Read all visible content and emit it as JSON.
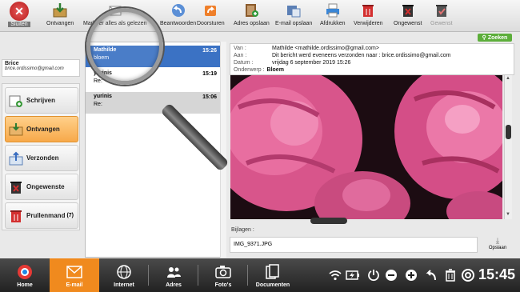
{
  "toolbar": {
    "close_label": "Sluiten",
    "buttons": [
      {
        "label": "Ontvangen",
        "icon": "inbox-download-icon"
      },
      {
        "label": "Markeer alles als gelezen",
        "icon": "mark-read-icon"
      },
      {
        "label": "Beantwoorden",
        "icon": "reply-icon"
      },
      {
        "label": "Doorsturen",
        "icon": "forward-icon"
      },
      {
        "label": "Adres opslaan",
        "icon": "save-address-icon"
      },
      {
        "label": "E-mail opslaan",
        "icon": "save-email-icon"
      },
      {
        "label": "Afdrukken",
        "icon": "printer-icon"
      },
      {
        "label": "Verwijderen",
        "icon": "trash-icon"
      },
      {
        "label": "Ongewenst",
        "icon": "junk-icon"
      },
      {
        "label": "Gewenst",
        "icon": "not-junk-icon"
      }
    ]
  },
  "user": {
    "name": "Brice",
    "email": "brice.ordissimo@gmail.com"
  },
  "folders": [
    {
      "label": "Schrijven",
      "count": ""
    },
    {
      "label": "Ontvangen",
      "count": ""
    },
    {
      "label": "Verzonden",
      "count": ""
    },
    {
      "label": "Ongewenste",
      "count": ""
    },
    {
      "label": "Prullenmand",
      "count": "(7)"
    }
  ],
  "messages": [
    {
      "from": "Mathilde",
      "time": "15:26",
      "subject": "bloem"
    },
    {
      "from": "yurinis",
      "time": "15:19",
      "subject": "Re:"
    },
    {
      "from": "yurinis",
      "time": "15:06",
      "subject": "Re:"
    }
  ],
  "search": {
    "label": "Zoeken"
  },
  "email_header": {
    "from_label": "Van :",
    "from_value": "Mathilde <mathilde.ordissimo@gmail.com>",
    "to_label": "Aan :",
    "to_value": "Dit bericht werd eveneens verzonden naar : brice.ordissimo@gmail.com",
    "date_label": "Datum :",
    "date_value": "vrijdag 6 september 2019 15:26",
    "subject_label": "Onderwerp :",
    "subject_value": "Bloem"
  },
  "attachments": {
    "label": "Bijlagen :",
    "file": "IMG_9371.JPG",
    "save_label": "Opslaan"
  },
  "taskbar": {
    "items": [
      {
        "label": "Home"
      },
      {
        "label": "E-mail"
      },
      {
        "label": "Internet"
      },
      {
        "label": "Adres"
      },
      {
        "label": "Foto's"
      },
      {
        "label": "Documenten"
      }
    ],
    "clock": "15:45"
  }
}
